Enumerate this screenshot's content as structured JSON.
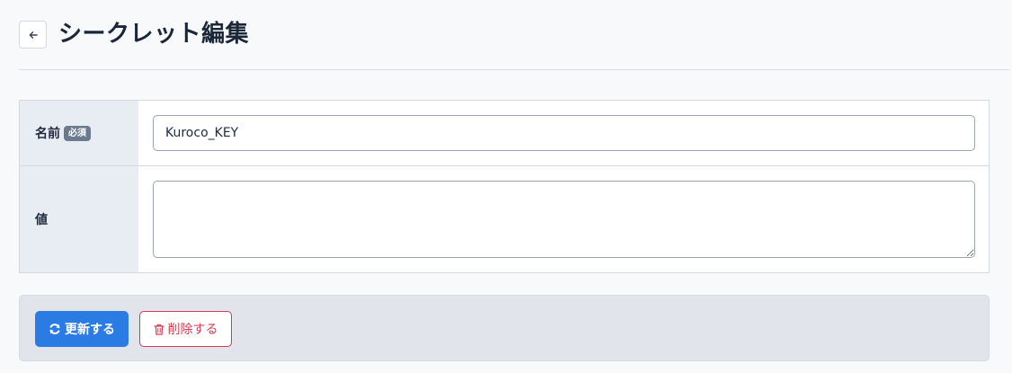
{
  "header": {
    "title": "シークレット編集",
    "back_icon": "arrow-left-icon"
  },
  "form": {
    "name_row": {
      "label": "名前",
      "required_badge": "必須",
      "value": "Kuroco_KEY"
    },
    "value_row": {
      "label": "値",
      "value": ""
    }
  },
  "actions": {
    "update_label": "更新する",
    "update_icon": "refresh-icon",
    "delete_label": "削除する",
    "delete_icon": "trash-icon"
  },
  "colors": {
    "primary": "#2a7be4",
    "danger": "#d8394f",
    "label_bg": "#e8edf4",
    "badge_bg": "#6c7a90"
  }
}
